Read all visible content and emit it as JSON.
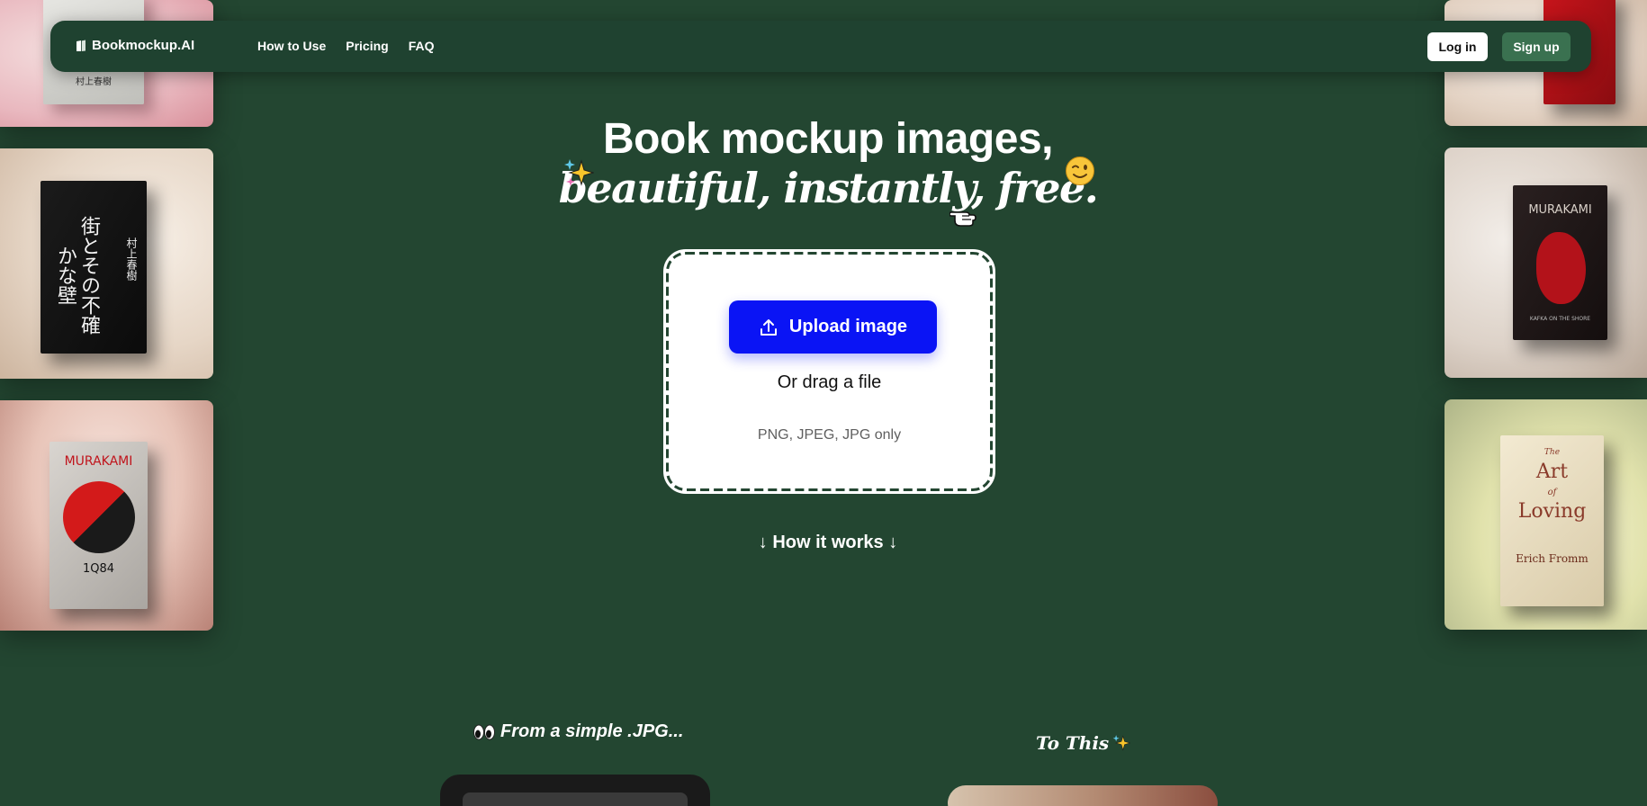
{
  "nav": {
    "logo_text": "Bookmockup.AI",
    "links": [
      "How to Use",
      "Pricing",
      "FAQ"
    ],
    "login_label": "Log in",
    "signup_label": "Sign up"
  },
  "hero": {
    "line1": "Book mockup images,",
    "line2": "beautiful, instantly, free."
  },
  "upload": {
    "button_label": "Upload image",
    "drag_text": "Or drag a file",
    "formats_text": "PNG, JPEG, JPG only"
  },
  "how_it_works": "↓ How it works ↓",
  "comparison": {
    "from_label": "From a simple .JPG...",
    "to_label": "To This"
  },
  "books": {
    "left_top_author": "村上春樹",
    "left_mid_title": "街とその不確かな壁",
    "left_mid_author": "村上春樹",
    "left_bottom_author": "MURAKAMI",
    "left_bottom_title": "1Q84",
    "right_mid_author": "MURAKAMI",
    "right_mid_title": "KAFKA ON THE SHORE",
    "right_bottom_title_1": "The",
    "right_bottom_title_2": "Art",
    "right_bottom_title_3": "of",
    "right_bottom_title_4": "Loving",
    "right_bottom_author": "Erich Fromm"
  },
  "colors": {
    "background": "#234631",
    "nav_bg": "#1f4230",
    "upload_button": "#0a14f5",
    "signup_button": "#3a7150"
  },
  "icons": [
    "book-logo-icon",
    "upload-icon",
    "sparkles-emoji",
    "wink-emoji",
    "pointing-hand-emoji",
    "eyes-emoji"
  ]
}
